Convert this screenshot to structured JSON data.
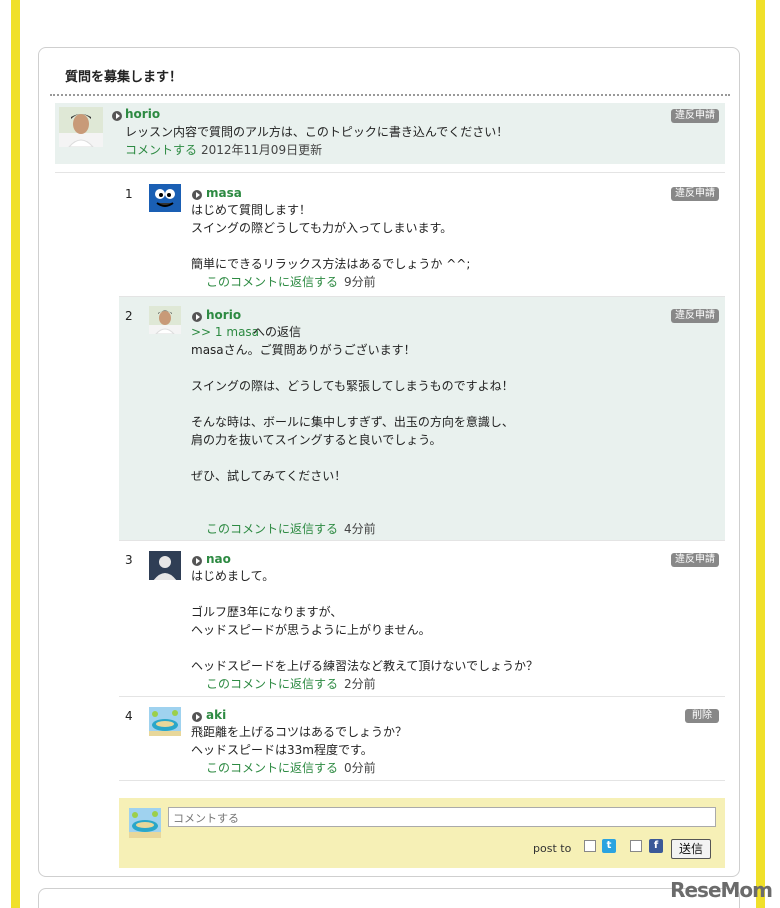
{
  "card": {
    "title": "質問を募集します！"
  },
  "topic": {
    "user": "horio",
    "report_label": "違反申請",
    "body": "レッスン内容で質問のアル方は、このトピックに書き込んでください！",
    "comment_link": "コメントする",
    "updated": "2012年11月09日更新"
  },
  "comments": [
    {
      "num": "1",
      "user": "masa",
      "report_label": "違反申請",
      "lines": [
        "はじめて質問します！",
        "スイングの際どうしても力が入ってしまいます。",
        "",
        "簡単にできるリラックス方法はあるでしょうか ^^;"
      ],
      "reply_link": "このコメントに返信する",
      "time": "9分前"
    },
    {
      "num": "2",
      "user": "horio",
      "report_label": "違反申請",
      "reply_ref": ">> 1 masa",
      "reply_suffix": "への返信",
      "lines": [
        "masaさん。ご質問ありがうございます！",
        "",
        "スイングの際は、どうしても緊張してしまうものですよね！",
        "",
        "そんな時は、ボールに集中しすぎず、出玉の方向を意識し、",
        "肩の力を抜いてスイングすると良いでしょう。",
        "",
        "ぜひ、試してみてください！"
      ],
      "reply_link": "このコメントに返信する",
      "time": "4分前"
    },
    {
      "num": "3",
      "user": "nao",
      "report_label": "違反申請",
      "lines": [
        "はじめまして。",
        "",
        "ゴルフ歴3年になりますが、",
        "ヘッドスピードが思うように上がりません。",
        "",
        "ヘッドスピードを上げる練習法など教えて頂けないでしょうか？"
      ],
      "reply_link": "このコメントに返信する",
      "time": "2分前"
    },
    {
      "num": "4",
      "user": "aki",
      "delete_label": "削除",
      "lines": [
        "飛距離を上げるコツはあるでしょうか？",
        "ヘッドスピードは33m程度です。"
      ],
      "reply_link": "このコメントに返信する",
      "time": "0分前"
    }
  ],
  "composer": {
    "placeholder": "コメントする",
    "post_to": "post to",
    "twitter_icon": "t",
    "facebook_icon": "f",
    "send_label": "送信"
  },
  "watermark": "ReseMom",
  "colors": {
    "accent_green": "#2d8a42",
    "highlight_bg": "#e9f1ee",
    "composer_bg": "#f6f0b6",
    "border_yellow": "#f0e02a"
  }
}
